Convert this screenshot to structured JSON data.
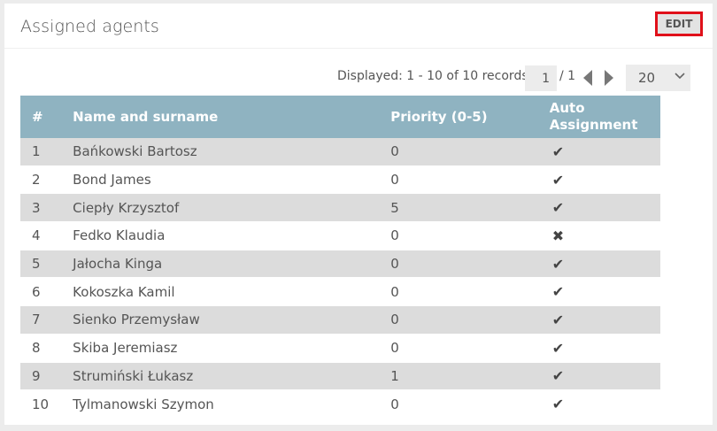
{
  "panel": {
    "title": "Assigned agents",
    "edit_label": "EDIT"
  },
  "pager": {
    "displayed_text": "Displayed: 1 - 10 of 10 records",
    "current_page": "1",
    "total_pages": "/ 1",
    "page_size": "20"
  },
  "table": {
    "headers": {
      "num": "#",
      "name": "Name and surname",
      "priority": "Priority (0-5)",
      "auto": "Auto Assignment"
    },
    "rows": [
      {
        "num": "1",
        "name": "Bańkowski Bartosz",
        "priority": "0",
        "auto": "✔"
      },
      {
        "num": "2",
        "name": "Bond James",
        "priority": "0",
        "auto": "✔"
      },
      {
        "num": "3",
        "name": "Ciepły Krzysztof",
        "priority": "5",
        "auto": "✔"
      },
      {
        "num": "4",
        "name": "Fedko Klaudia",
        "priority": "0",
        "auto": "✖"
      },
      {
        "num": "5",
        "name": "Jałocha Kinga",
        "priority": "0",
        "auto": "✔"
      },
      {
        "num": "6",
        "name": "Kokoszka Kamil",
        "priority": "0",
        "auto": "✔"
      },
      {
        "num": "7",
        "name": "Sienko Przemysław",
        "priority": "0",
        "auto": "✔"
      },
      {
        "num": "8",
        "name": "Skiba Jeremiasz",
        "priority": "0",
        "auto": "✔"
      },
      {
        "num": "9",
        "name": "Strumiński Łukasz",
        "priority": "1",
        "auto": "✔"
      },
      {
        "num": "10",
        "name": "Tylmanowski Szymon",
        "priority": "0",
        "auto": "✔"
      }
    ]
  },
  "colors": {
    "header_bg": "#8fb3c1",
    "edit_border": "#e0101a",
    "row_alt": "#dcdcdc"
  }
}
